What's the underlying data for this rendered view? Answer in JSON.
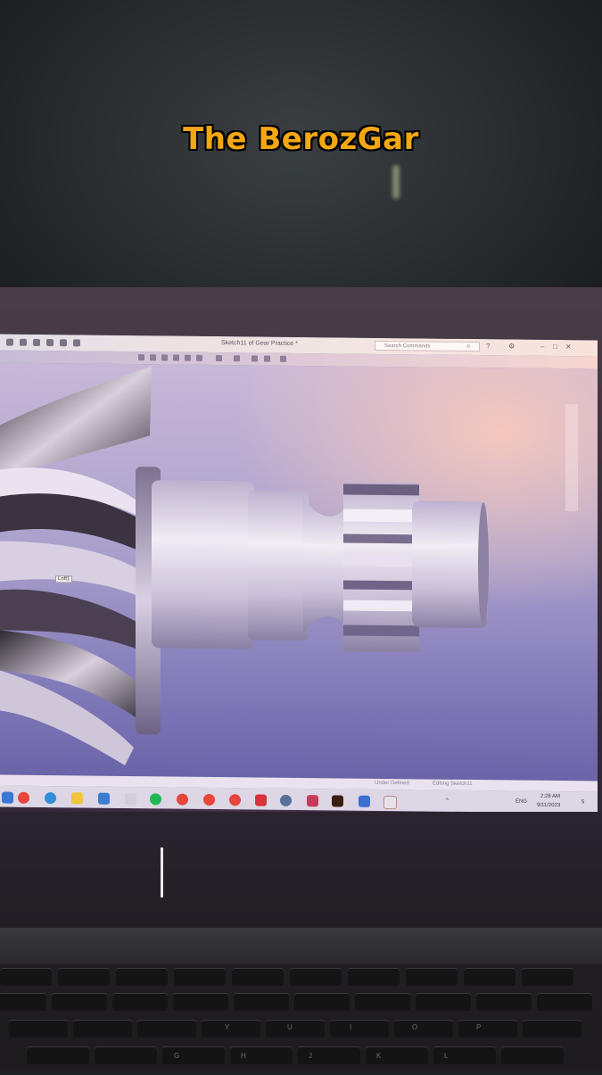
{
  "watermark": {
    "text": "The BerozGar"
  },
  "cad_window": {
    "document_title": "Sketch11 of Gear Practice *",
    "search_placeholder": "Search Commands",
    "feature_tooltip": "Loft1",
    "status_items": [
      "Under Defined",
      "Editing Sketch11"
    ]
  },
  "taskbar": {
    "apps": [
      "start",
      "chrome",
      "edge",
      "file-explorer",
      "mail",
      "store",
      "spotify",
      "chrome-2",
      "chrome-3",
      "chrome-4",
      "acrobat",
      "settings",
      "office",
      "illustrator",
      "notepad",
      "solidworks"
    ],
    "language": "ENG",
    "time": "2:28 AM",
    "date": "9/11/2023",
    "notifications": "5"
  },
  "keyboard": {
    "labels": [
      "Y",
      "U",
      "I",
      "O",
      "P",
      "G",
      "H",
      "J",
      "K",
      "L"
    ]
  },
  "colors": {
    "watermark_fill": "#f3a712",
    "watermark_outline": "#000000",
    "viewport_top": "#c8b8d8",
    "viewport_bottom": "#6a64a8",
    "part_metal": "#d9d0e6"
  }
}
